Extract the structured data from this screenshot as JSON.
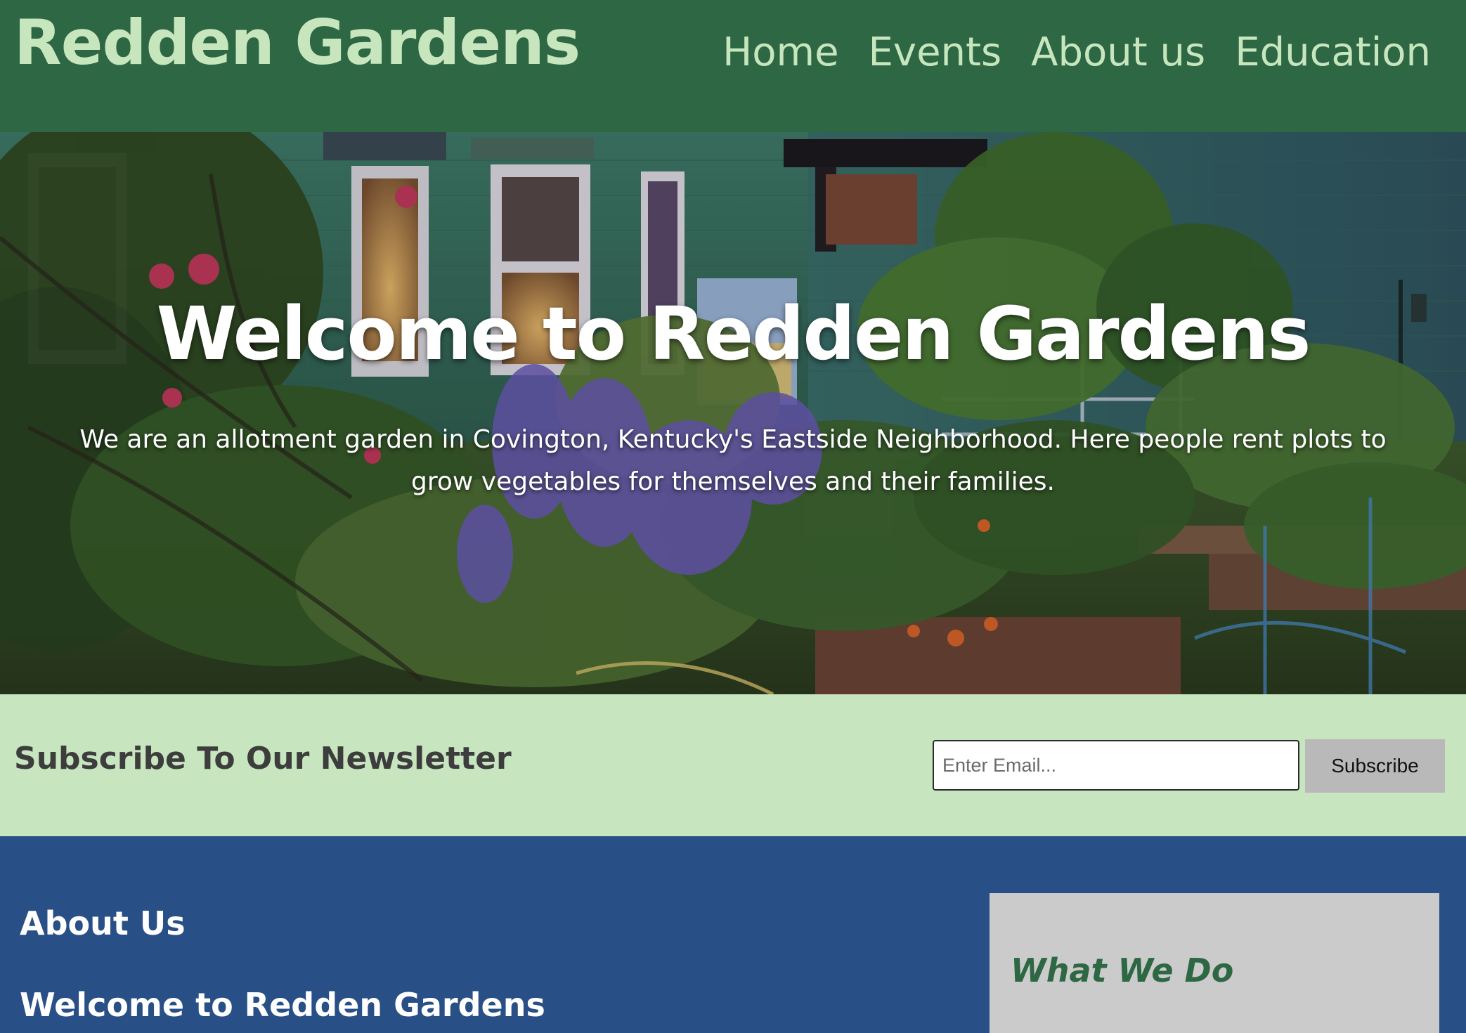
{
  "header": {
    "site_title": "Redden Gardens",
    "nav": [
      {
        "label": "Home"
      },
      {
        "label": "Events"
      },
      {
        "label": "About us"
      },
      {
        "label": "Education"
      }
    ]
  },
  "hero": {
    "heading": "Welcome to Redden Gardens",
    "text": "We are an allotment garden in Covington, Kentucky's Eastside Neighborhood. Here people rent plots to grow vegetables for themselves and their families."
  },
  "newsletter": {
    "heading": "Subscribe To Our Newsletter",
    "email_placeholder": "Enter Email...",
    "email_value": "",
    "subscribe_label": "Subscribe"
  },
  "about": {
    "heading": "About Us",
    "subheading": "Welcome to Redden Gardens"
  },
  "sidebar": {
    "heading": "What We Do"
  },
  "colors": {
    "header_bg": "#2e6744",
    "header_text": "#c7e6be",
    "newsletter_bg": "#c7e6c0",
    "about_bg": "#284f86",
    "sidebar_bg": "#cbcbcb",
    "sidebar_heading": "#2e6744",
    "subscribe_button_bg": "#b9b9b9"
  }
}
